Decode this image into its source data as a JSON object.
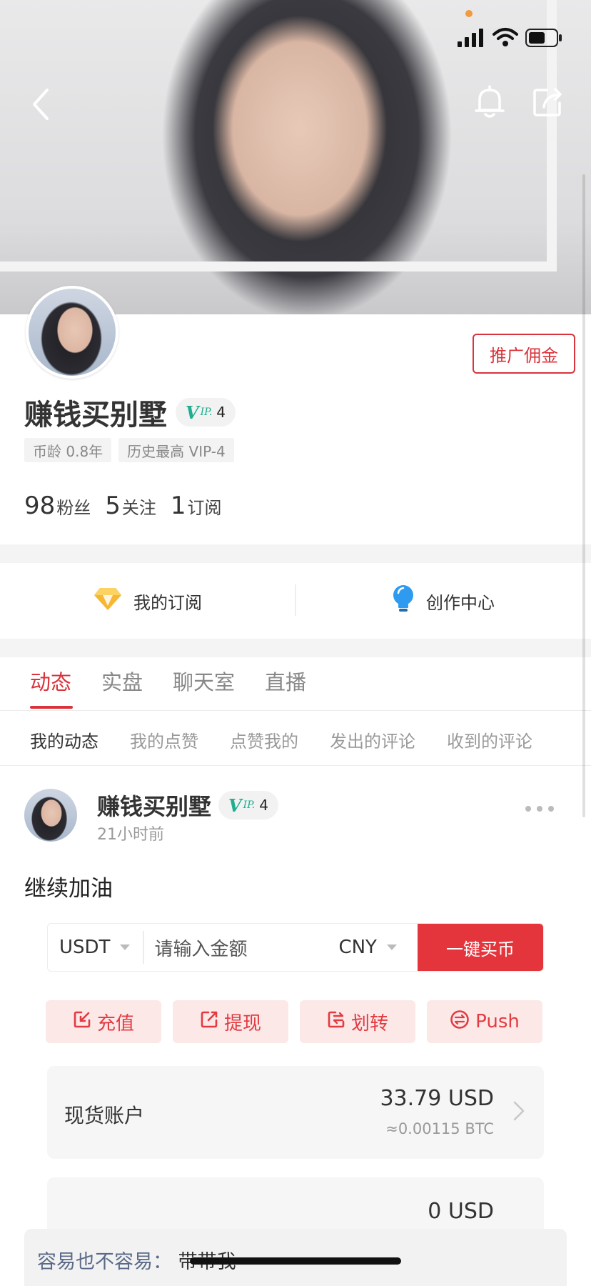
{
  "header": {
    "icons": [
      "back-icon",
      "bell-icon",
      "share-icon",
      "cellular-signal-icon",
      "wifi-icon",
      "battery-icon"
    ],
    "status_dot_color": "#f19a3e"
  },
  "profile": {
    "name": "赚钱买别墅",
    "vip_level": "4",
    "vip_mark": "V",
    "vip_suffix": "IP.",
    "promo_button": "推广佣金",
    "tags": [
      "币龄 0.8年",
      "历史最高 VIP-4"
    ],
    "stats": [
      {
        "num": "98",
        "label": "粉丝"
      },
      {
        "num": "5",
        "label": "关注"
      },
      {
        "num": "1",
        "label": "订阅"
      }
    ]
  },
  "quick": {
    "subscription": "我的订阅",
    "creator": "创作中心"
  },
  "tabs": [
    "动态",
    "实盘",
    "聊天室",
    "直播"
  ],
  "subtabs": [
    "我的动态",
    "我的点赞",
    "点赞我的",
    "发出的评论",
    "收到的评论"
  ],
  "post": {
    "name": "赚钱买别墅",
    "vip_level": "4",
    "time": "21小时前",
    "text": "继续加油"
  },
  "buy": {
    "coin": "USDT",
    "placeholder": "请输入金额",
    "fiat": "CNY",
    "button": "一键买币"
  },
  "actions": [
    "充值",
    "提现",
    "划转",
    "Push"
  ],
  "accounts": [
    {
      "title": "现货账户",
      "value": "33.79 USD",
      "sub": "≈0.00115 BTC"
    },
    {
      "title": "",
      "value": "0 USD",
      "sub": ""
    }
  ],
  "chat": {
    "text": "容易也不容易：",
    "trailing": "带带我"
  },
  "colors": {
    "accent": "#d9333b",
    "vip_green": "#1fae8f",
    "action_bg": "#fde8e8"
  }
}
